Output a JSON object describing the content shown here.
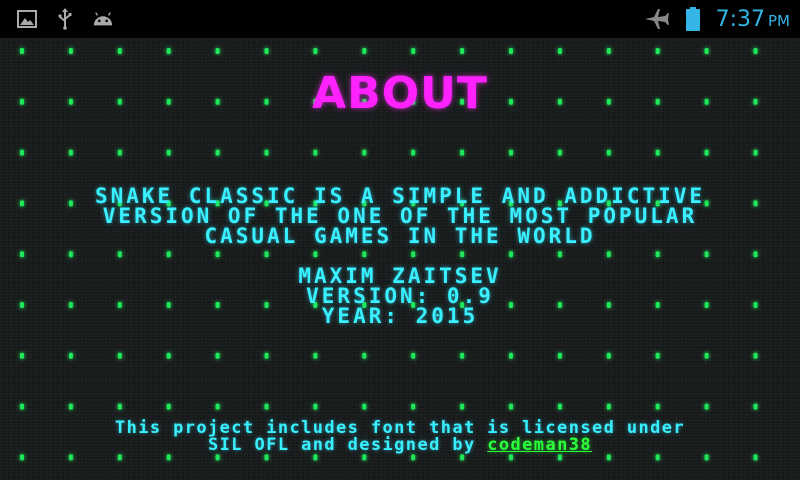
{
  "status_bar": {
    "icons_left": [
      "gallery-icon",
      "usb-icon",
      "android-debug-icon"
    ],
    "icons_right": [
      "airplane-mode-icon",
      "battery-icon"
    ],
    "time": "7:37",
    "ampm": "PM",
    "clock_color": "#33b5e5"
  },
  "about": {
    "title": "ABOUT",
    "description_lines": [
      "SNAKE CLASSIC IS A SIMPLE AND ADDICTIVE",
      "VERSION OF THE ONE OF THE MOST POPULAR",
      "CASUAL GAMES IN THE WORLD"
    ],
    "author": "MAXIM ZAITSEV",
    "version": "VERSION: 0.9",
    "year": "YEAR: 2015",
    "license_line1": "This project includes font that is licensed under",
    "license_line2_prefix": "SIL OFL and designed by ",
    "license_link": "codeman38"
  },
  "colors": {
    "title": "#ff22ff",
    "text": "#38f0ff",
    "link": "#2cff3c",
    "dot": "#1ee85a",
    "background": "#181b1b"
  }
}
